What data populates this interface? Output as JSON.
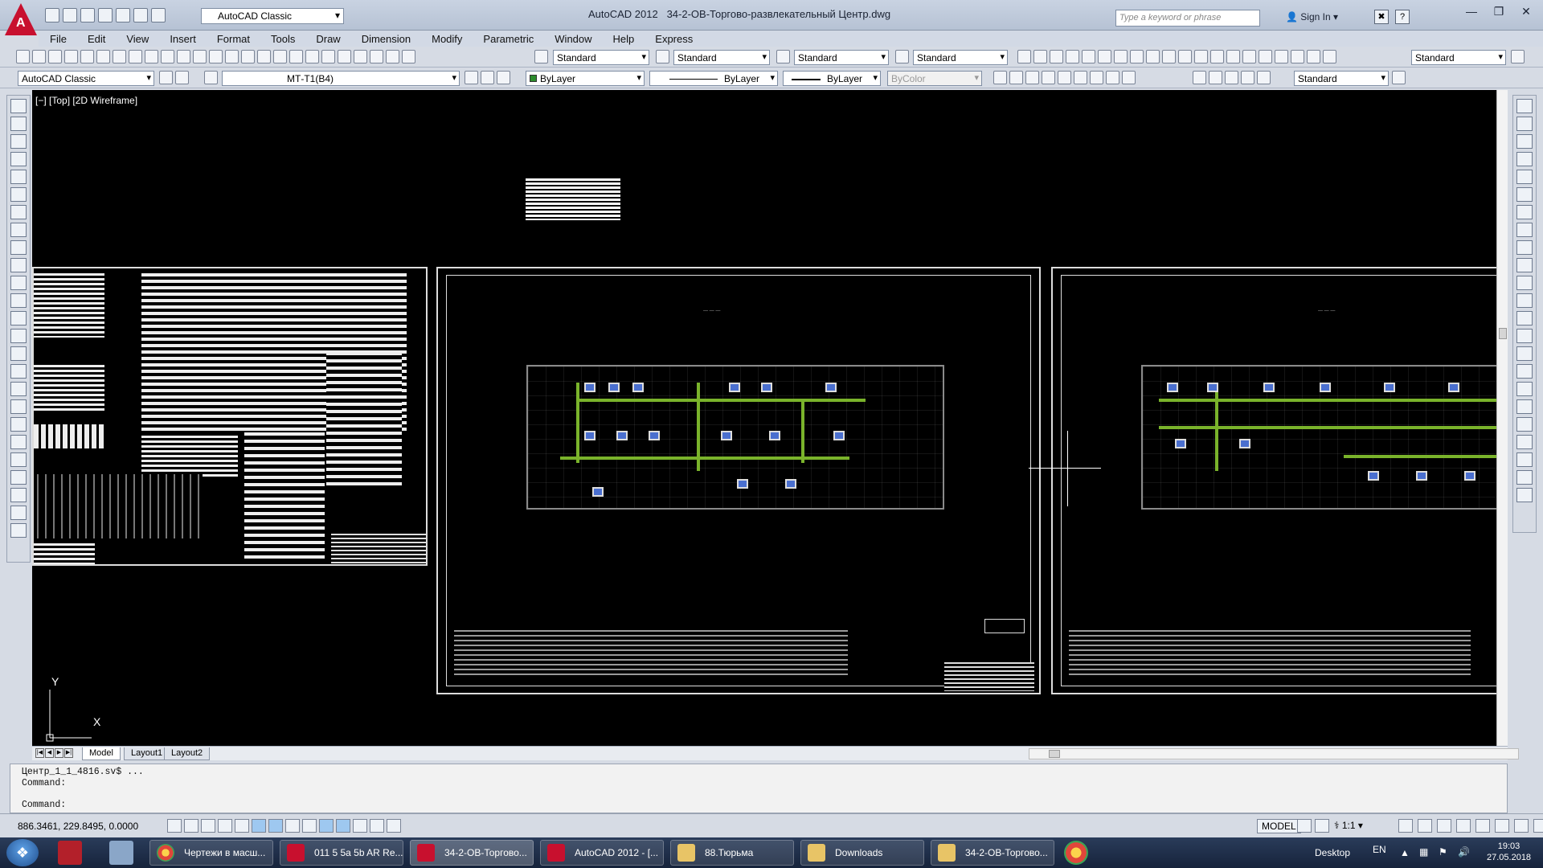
{
  "title": {
    "app_name": "AutoCAD 2012",
    "file_name": "34-2-ОВ-Торгово-развлекательный Центр.dwg",
    "workspace": "AutoCAD Classic",
    "search_placeholder": "Type a keyword or phrase",
    "sign_in": "Sign In"
  },
  "menu": [
    "File",
    "Edit",
    "View",
    "Insert",
    "Format",
    "Tools",
    "Draw",
    "Dimension",
    "Modify",
    "Parametric",
    "Window",
    "Help",
    "Express"
  ],
  "styles_toolbar": {
    "text_style": "Standard",
    "dim_style": "Standard",
    "table_style": "Standard",
    "mleader_style": "Standard",
    "right_style": "Standard"
  },
  "layers_toolbar": {
    "workspace": "AutoCAD Classic",
    "layer": "МТ-Т1(В4)",
    "color": "ByLayer",
    "linetype": "ByLayer",
    "lineweight": "ByLayer",
    "plotstyle": "ByColor",
    "style": "Standard"
  },
  "viewport": {
    "label": "[−] [Top] [2D Wireframe]"
  },
  "axis": {
    "x": "X",
    "y": "Y"
  },
  "tabs": [
    "Model",
    "Layout1",
    "Layout2"
  ],
  "command_history": [
    "Центр_1_1_4816.sv$ ...",
    "Command:"
  ],
  "command_prompt": "Command:",
  "status": {
    "coordinates": "886.3461, 229.8495, 0.0000",
    "model": "MODEL",
    "scale": "1:1"
  },
  "taskbar": {
    "tasks": [
      {
        "label": "Чертежи в масш...",
        "icon": "chrome-icon"
      },
      {
        "label": "011 5  5a 5b AR Re...",
        "icon": "autocad-icon"
      },
      {
        "label": "34-2-ОВ-Торгово...",
        "icon": "autocad-icon"
      },
      {
        "label": "AutoCAD 2012 - [...",
        "icon": "autocad-icon"
      },
      {
        "label": "88.Тюрьма",
        "icon": "folder-icon"
      },
      {
        "label": "Downloads",
        "icon": "folder-icon"
      },
      {
        "label": "34-2-ОВ-Торгово...",
        "icon": "folder-icon"
      }
    ],
    "desktop": "Desktop",
    "language": "EN",
    "time": "19:03",
    "date": "27.05.2018"
  },
  "colors": {
    "canvas": "#000000",
    "duct": "#7ab32b",
    "room_equipment": "#4a6fcf",
    "chrome": "#d6dbe4"
  }
}
